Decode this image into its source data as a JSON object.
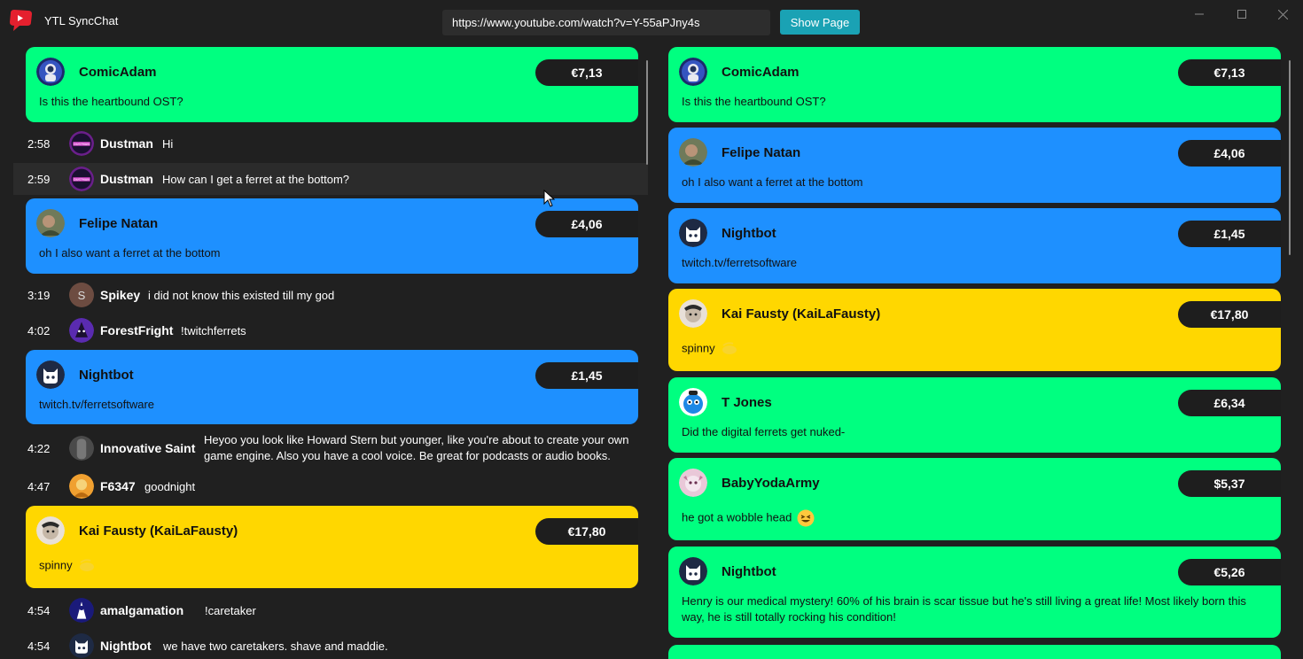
{
  "app": {
    "title": "YTL SyncChat",
    "accent": "#1aa2b4"
  },
  "toolbar": {
    "url": "https://www.youtube.com/watch?v=Y-55aPJny4s",
    "show_label": "Show Page"
  },
  "colors": {
    "green": "#00ff80",
    "blue": "#1e90ff",
    "yellow": "#ffd700",
    "background": "#202020"
  },
  "left": {
    "items": [
      {
        "kind": "superchat",
        "name": "ComicAdam",
        "amount": "€7,13",
        "message": "Is this the heartbound OST?",
        "color": "green",
        "avatar_icon": "astronaut-avatar-icon"
      },
      {
        "kind": "chat",
        "time": "2:58",
        "name": "Dustman",
        "message": "Hi",
        "avatar_icon": "dustman-avatar-icon"
      },
      {
        "kind": "chat",
        "time": "2:59",
        "name": "Dustman",
        "message": "How can I get a ferret at the bottom?",
        "avatar_icon": "dustman-avatar-icon",
        "highlighted": true
      },
      {
        "kind": "superchat",
        "name": "Felipe Natan",
        "amount": "£4,06",
        "message": "oh I also want a ferret at the bottom",
        "color": "blue",
        "avatar_icon": "photo-avatar-icon"
      },
      {
        "kind": "chat",
        "time": "3:19",
        "name": "Spikey",
        "message": "i did not know this existed till my god",
        "avatar_icon": "letter-s-avatar-icon",
        "avatar_letter": "S"
      },
      {
        "kind": "chat",
        "time": "4:02",
        "name": "ForestFright",
        "message": "!twitchferrets",
        "avatar_icon": "forest-avatar-icon"
      },
      {
        "kind": "superchat",
        "name": "Nightbot",
        "amount": "£1,45",
        "message": "twitch.tv/ferretsoftware",
        "color": "blue",
        "avatar_icon": "nightbot-avatar-icon"
      },
      {
        "kind": "chat",
        "time": "4:22",
        "name": "Innovative Saint",
        "message": "Heyoo you look like Howard Stern but younger, like you're about to create your own game engine. Also you have a cool voice. Be great for podcasts or audio books.",
        "avatar_icon": "saint-avatar-icon"
      },
      {
        "kind": "chat",
        "time": "4:47",
        "name": "F6347",
        "message": "goodnight",
        "avatar_icon": "orange-avatar-icon"
      },
      {
        "kind": "superchat",
        "name": "Kai Fausty (KaiLaFausty)",
        "amount": "€17,80",
        "message": "spinny",
        "color": "yellow",
        "avatar_icon": "cartoon-avatar-icon",
        "emoji_icon": "lemon-emoji-icon"
      },
      {
        "kind": "chat",
        "time": "4:54",
        "name": "amalgamation",
        "message": "!caretaker",
        "avatar_icon": "amalgamation-avatar-icon"
      },
      {
        "kind": "chat",
        "time": "4:54",
        "name": "Nightbot",
        "message": "we have two caretakers. shave and maddie.",
        "avatar_icon": "nightbot-avatar-icon"
      }
    ]
  },
  "right": {
    "items": [
      {
        "name": "ComicAdam",
        "amount": "€7,13",
        "message": "Is this the heartbound OST?",
        "color": "green",
        "avatar_icon": "astronaut-avatar-icon"
      },
      {
        "name": "Felipe Natan",
        "amount": "£4,06",
        "message": "oh I also want a ferret at the bottom",
        "color": "blue",
        "avatar_icon": "photo-avatar-icon"
      },
      {
        "name": "Nightbot",
        "amount": "£1,45",
        "message": "twitch.tv/ferretsoftware",
        "color": "blue",
        "avatar_icon": "nightbot-avatar-icon"
      },
      {
        "name": "Kai Fausty (KaiLaFausty)",
        "amount": "€17,80",
        "message": "spinny",
        "color": "yellow",
        "avatar_icon": "cartoon-avatar-icon",
        "emoji_icon": "lemon-emoji-icon"
      },
      {
        "name": "T Jones",
        "amount": "£6,34",
        "message": "Did the digital ferrets get nuked-",
        "color": "green",
        "avatar_icon": "blue-creature-avatar-icon"
      },
      {
        "name": "BabyYodaArmy",
        "amount": "$5,37",
        "message": "he got a wobble head",
        "color": "green",
        "avatar_icon": "pink-avatar-icon",
        "emoji_icon": "laughing-emoji-icon"
      },
      {
        "name": "Nightbot",
        "amount": "€5,26",
        "message": "Henry is our medical mystery! 60% of his brain is scar tissue but he's still living a great life! Most likely born this way, he is still totally rocking his condition!",
        "color": "green",
        "avatar_icon": "nightbot-avatar-icon"
      }
    ]
  }
}
